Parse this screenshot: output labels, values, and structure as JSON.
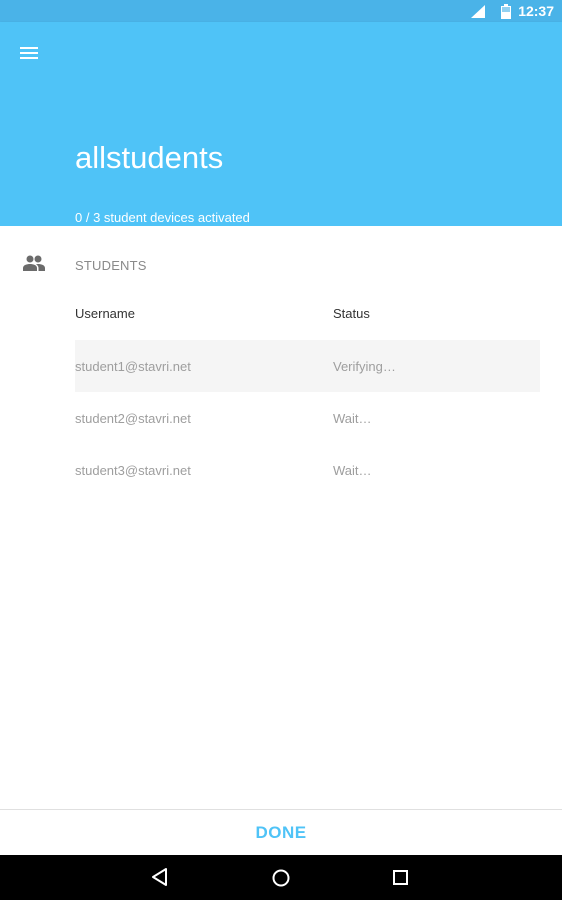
{
  "status_bar": {
    "time": "12:37"
  },
  "header": {
    "title": "allstudents",
    "subtitle": "0 / 3 student devices activated"
  },
  "section": {
    "title": "STUDENTS"
  },
  "table": {
    "columns": [
      "Username",
      "Status"
    ],
    "rows": [
      {
        "username": "student1@stavri.net",
        "status": "Verifying…"
      },
      {
        "username": "student2@stavri.net",
        "status": "Wait…"
      },
      {
        "username": "student3@stavri.net",
        "status": "Wait…"
      }
    ]
  },
  "footer": {
    "done_label": "DONE"
  },
  "colors": {
    "accent": "#4fc3f7",
    "status_bar": "#4ab3e8"
  }
}
